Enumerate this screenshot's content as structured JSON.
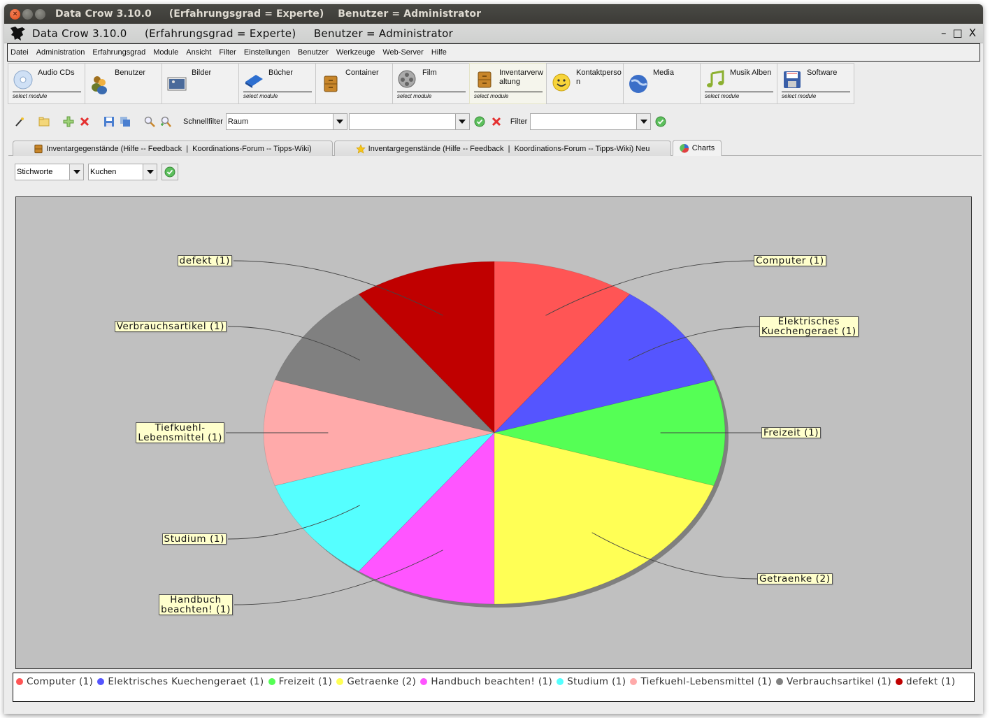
{
  "window": {
    "os_title": "Data Crow 3.10.0     (Erfahrungsgrad = Experte)    Benutzer = Administrator",
    "app_title": "Data Crow 3.10.0     (Erfahrungsgrad = Experte)     Benutzer = Administrator",
    "controls": {
      "minimize": "–",
      "maximize": "□",
      "close": "X"
    }
  },
  "menu": [
    "Datei",
    "Administration",
    "Erfahrungsgrad",
    "Module",
    "Ansicht",
    "Filter",
    "Einstellungen",
    "Benutzer",
    "Werkzeuge",
    "Web-Server",
    "Hilfe"
  ],
  "modules": [
    {
      "label": "Audio CDs",
      "icon": "cd-icon",
      "sub": "select module"
    },
    {
      "label": "Benutzer",
      "icon": "users-icon",
      "sub": ""
    },
    {
      "label": "Bilder",
      "icon": "picture-icon",
      "sub": ""
    },
    {
      "label": "Bücher",
      "icon": "book-icon",
      "sub": "select module"
    },
    {
      "label": "Container",
      "icon": "cabinet-icon",
      "sub": ""
    },
    {
      "label": "Film",
      "icon": "film-reel-icon",
      "sub": "select module"
    },
    {
      "label": "Inventarverwaltung",
      "icon": "cabinet-icon",
      "sub": "select module",
      "active": true
    },
    {
      "label": "Kontaktperson",
      "icon": "smiley-icon",
      "sub": ""
    },
    {
      "label": "Media",
      "icon": "globe-icon",
      "sub": ""
    },
    {
      "label": "Musik Alben",
      "icon": "music-note-icon",
      "sub": "select module"
    },
    {
      "label": "Software",
      "icon": "floppy-disk-icon",
      "sub": "select module"
    }
  ],
  "toolbar": {
    "icons": [
      "magic-wand-icon",
      "folder-icon",
      "add-icon",
      "delete-icon",
      "save-icon",
      "save-all-icon",
      "search-icon",
      "advanced-search-icon"
    ],
    "quickfilter_label": "Schnellfilter",
    "quickfilter_field": "Raum",
    "quickfilter_value": "",
    "filter_label": "Filter",
    "filter_value": ""
  },
  "tabs": [
    {
      "label": "Inventargegenstände (Hilfe -- Feedback  |  Koordinations-Forum -- Tipps-Wiki)",
      "icon": "cabinet-icon"
    },
    {
      "label": "Inventargegenstände (Hilfe -- Feedback  |  Koordinations-Forum -- Tipps-Wiki) Neu",
      "icon": "star-icon"
    },
    {
      "label": "Charts",
      "icon": "pie-chart-icon",
      "selected": true
    }
  ],
  "chart_controls": {
    "field": "Stichworte",
    "chart_type": "Kuchen"
  },
  "chart_data": {
    "type": "pie",
    "title": "",
    "style": "3d-elliptical",
    "start": "top",
    "direction": "clockwise",
    "slices": [
      {
        "label": "Computer",
        "value": 1,
        "color": "#ff5555",
        "label_text": "Computer (1)"
      },
      {
        "label": "Elektrisches Kuechengeraet",
        "value": 1,
        "color": "#5555ff",
        "label_text": "Elektrisches\nKuechengeraet (1)"
      },
      {
        "label": "Freizeit",
        "value": 1,
        "color": "#55ff55",
        "label_text": "Freizeit (1)"
      },
      {
        "label": "Getraenke",
        "value": 2,
        "color": "#ffff55",
        "label_text": "Getraenke (2)"
      },
      {
        "label": "Handbuch beachten!",
        "value": 1,
        "color": "#ff55ff",
        "label_text": "Handbuch\nbeachten! (1)"
      },
      {
        "label": "Studium",
        "value": 1,
        "color": "#55ffff",
        "label_text": "Studium (1)"
      },
      {
        "label": "Tiefkuehl-Lebensmittel",
        "value": 1,
        "color": "#ffaaaa",
        "label_text": "Tiefkuehl-\nLebensmittel (1)"
      },
      {
        "label": "Verbrauchsartikel",
        "value": 1,
        "color": "#808080",
        "label_text": "Verbrauchsartikel (1)"
      },
      {
        "label": "defekt",
        "value": 1,
        "color": "#c00000",
        "label_text": "defekt (1)"
      }
    ],
    "legend": {
      "placement": "bottom",
      "entries": [
        "Computer (1)",
        "Elektrisches Kuechengeraet (1)",
        "Freizeit (1)",
        "Getraenke (2)",
        "Handbuch beachten! (1)",
        "Studium (1)",
        "Tiefkuehl-Lebensmittel (1)",
        "Verbrauchsartikel (1)",
        "defekt (1)"
      ]
    }
  }
}
